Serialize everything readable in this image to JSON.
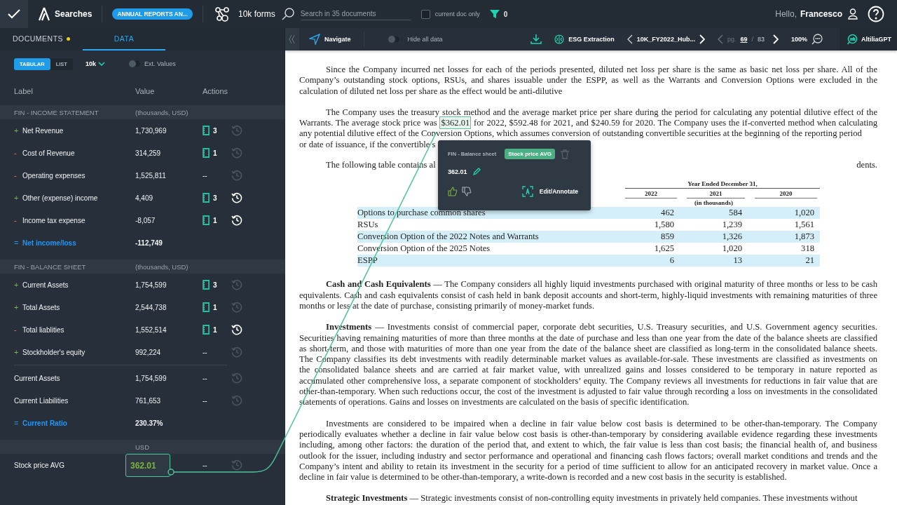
{
  "topbar": {
    "searches_label": "Searches",
    "project_pill": "ANNUAL REPORTS AN...",
    "collection": "10k forms",
    "search": {
      "placeholder": "Search in 35 documents"
    },
    "current_doc_only": {
      "label": "current doc only",
      "checked": false
    },
    "filter_count": "0",
    "greeting": "Hello,",
    "user_name": "Francesco"
  },
  "panel_tabs": [
    {
      "label": "DOCUMENTS",
      "selected": false,
      "notification": true
    },
    {
      "label": "DATA",
      "selected": true,
      "notification": false
    }
  ],
  "view_modes": [
    {
      "label": "TABULAR",
      "selected": true
    },
    {
      "label": "LIST",
      "selected": false
    }
  ],
  "doc_type": "10k",
  "ext_values": {
    "label": "Ext. Values",
    "on": false
  },
  "table": {
    "columns": [
      "Label",
      "Value",
      "Actions"
    ],
    "sections": [
      {
        "title": "FIN - INCOME STATEMENT",
        "unit": "(thousands, USD)",
        "rows": [
          {
            "kind": "add",
            "sign": "+",
            "label": "Net Revenue",
            "value": "1,730,969",
            "linked_docs": true,
            "sources": "3",
            "history_active": false
          },
          {
            "kind": "subtract",
            "sign": "-",
            "label": "Cost of Revenue",
            "value": "314,259",
            "linked_docs": true,
            "sources": "1",
            "history_active": false
          },
          {
            "kind": "subtract",
            "sign": "-",
            "label": "Operating expenses",
            "value": "1,525,811",
            "linked_docs": false,
            "sources": "--",
            "history_active": false
          },
          {
            "kind": "add",
            "sign": "+",
            "label": "Other (expense) income",
            "value": "4,409",
            "linked_docs": true,
            "sources": "3",
            "history_active": true
          },
          {
            "kind": "subtract",
            "sign": "-",
            "label": "Income tax expense",
            "value": "-8,057",
            "linked_docs": true,
            "sources": "1",
            "history_active": true
          },
          {
            "kind": "total",
            "sign": "=",
            "label": "Net income/loss",
            "value": "-112,749"
          }
        ]
      },
      {
        "title": "FIN - BALANCE SHEET",
        "unit": "(thousands, USD)",
        "rows": [
          {
            "kind": "add",
            "sign": "+",
            "label": "Current Assets",
            "value": "1,754,599",
            "linked_docs": true,
            "sources": "3",
            "history_active": false
          },
          {
            "kind": "add",
            "sign": "+",
            "label": "Total Assets",
            "value": "2,544,738",
            "linked_docs": true,
            "sources": "1",
            "history_active": false
          },
          {
            "kind": "subtract",
            "sign": "-",
            "label": "Total liablities",
            "value": "1,552,514",
            "linked_docs": true,
            "sources": "1",
            "history_active": true
          },
          {
            "kind": "add",
            "sign": "+",
            "label": "Stockholder's equity",
            "value": "992,224",
            "linked_docs": false,
            "sources": "--",
            "history_active": false
          },
          {
            "kind": "plain",
            "label": "Current Assets",
            "value": "1,754,599",
            "linked_docs": false,
            "sources": "--",
            "history_active": false,
            "divider_before": true
          },
          {
            "kind": "plain",
            "label": "Current Liabilities",
            "value": "761,653",
            "linked_docs": false,
            "sources": "--",
            "history_active": false
          },
          {
            "kind": "total",
            "sign": "=",
            "label": "Current Ratio",
            "value": "230.37%"
          }
        ]
      },
      {
        "unit": "USD",
        "rows": [
          {
            "kind": "plain",
            "label": "Stock price AVG",
            "value": "362.01",
            "linked": true,
            "linked_docs": false,
            "sources": "--",
            "history_active": false
          }
        ]
      }
    ]
  },
  "doc_toolbar": {
    "navigate": "Navigate",
    "hide_all_data": {
      "label": "Hide all data",
      "on": false
    },
    "extraction": "ESG Extraction",
    "document_name": "10K_FY2022_Hub...",
    "page_prefix": "pg.",
    "page": "69",
    "page_separator": "/",
    "page_total": "83",
    "zoom": "100%",
    "assistant": "AltiliaGPT"
  },
  "document": {
    "blocks": [
      {
        "kind": "paragraph",
        "lines": [
          "Since the Company incurred net losses for each of the periods presented, diluted net loss per share is the same as basic net loss per share. All of the",
          "Company’s outstanding stock options, RSUs, and shares issuable under the ESPP, as well as the Warrants and Conversion Options were excluded in the",
          "calculation of diluted net loss per share as the effect would be anti-dilutive"
        ]
      },
      {
        "kind": "paragraph",
        "lines": [
          "The Company uses the treasury stock method and the average market price per share during the period for calculating any potential dilutive effect of the",
          {
            "before": "Warrants. The average stock price was",
            "marked": "$362.01",
            "after": "for 2022, $592.48 for 2021, and $240.59 for 2020. The Company uses the if-converted method when calculating"
          },
          "any potential dilutive effect of the Conversion Options, which assumes conversion of outstanding convertible securities at the beginning of the reporting period"
        ]
      },
      {
        "kind": "fragment",
        "text": "or date of issuance, if the convertible s"
      },
      {
        "kind": "split",
        "left": "The following table contains al",
        "right": "dents."
      },
      {
        "kind": "table",
        "group_header": "Year Ended December 31,",
        "years": [
          "2022",
          "2021",
          "2020"
        ],
        "unit_note": "(in thousands)",
        "rows": [
          {
            "label": "Options to purchase common shares",
            "values": [
              "462",
              "584",
              "1,020"
            ],
            "highlighted": true
          },
          {
            "label": "RSUs",
            "values": [
              "1,580",
              "1,239",
              "1,561"
            ],
            "highlighted": false
          },
          {
            "label": "Conversion Option of the 2022 Notes and Warrants",
            "values": [
              "859",
              "1,326",
              "1,873"
            ],
            "highlighted": true
          },
          {
            "label": "Conversion Option of the 2025 Notes",
            "values": [
              "1,625",
              "1,020",
              "318"
            ],
            "highlighted": false
          },
          {
            "label": "ESPP",
            "values": [
              "6",
              "13",
              "21"
            ],
            "highlighted": true
          }
        ]
      },
      {
        "kind": "paragraph",
        "lines": [
          "**Cash and Cash Equivalents** — The Company considers all highly liquid investments purchased with original maturity of three months or less to be cash",
          "equivalents. Cash and cash equivalents consist of cash held in bank deposit accounts and short-term, highly-liquid investments with remaining maturities of three",
          "months or less at the date of purchase, consisting primarily of money-market funds."
        ]
      },
      {
        "kind": "paragraph",
        "lines": [
          "**Investments** — Investments consist of commercial paper, corporate debt securities, U.S. Treasury securities, and U.S. Government agency securities.",
          "Securities having remaining maturities of more than three months at the date of purchase and less than one year from the date of the balance sheets are classified",
          "as short-term, and those with maturities of more than one year from the date of the balance sheet are classified as long-term in the consolidated balance sheets.",
          "The Company classifies its debt investments with readily determinable market values as available-for-sale. These investments are classified as investments on",
          "the consolidated balance sheets and are carried at fair market value, with unrealized gains and losses considered to be temporary in nature reported as",
          "accumulated other comprehensive loss, a separate component of stockholders’ equity. The Company reviews all investments for reductions in fair value that are",
          "other-than-temporary. When such reductions occur, the cost of the investment is adjusted to fair value through recording a loss on investments in the consolidated",
          "statements of operations. Gains and losses on investments are calculated on the basis of specific identification."
        ]
      },
      {
        "kind": "paragraph",
        "lines": [
          "Investments are considered to be impaired when a decline in fair value below cost basis is determined to be other-than-temporary. The Company",
          "periodically evaluates whether a decline in fair value below cost basis is other-than-temporary by considering available evidence regarding these investments",
          "including, among other factors: the duration of the period that, and extent to which, the fair value is less than cost basis; the financial health of, and business",
          "outlook for the issuer, including industry and sector performance and operational and financing cash flows factors; overall market conditions and trends and the",
          "Company’s intent and ability to retain its investment in the security for a period of time sufficient to allow for an anticipated recovery in market value. Once a",
          "decline in fair value is determined to be other-than-temporary, a write-down is recorded and a new cost basis in the security is established."
        ]
      },
      {
        "kind": "paragraph",
        "lines": [
          "**Strategic Investments** — Strategic investments consist of non-controlling equity investments in privately held companies. These investments without"
        ]
      }
    ]
  },
  "popover": {
    "section": "FIN - Balance sheet",
    "field_tag": "Stock price AVG",
    "value": "362.01",
    "action": "Edit/Annotate"
  }
}
